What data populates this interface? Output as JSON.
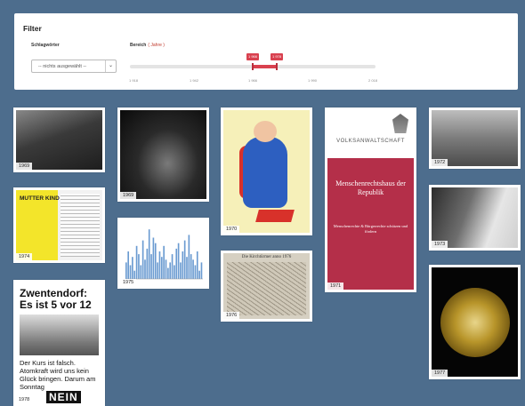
{
  "filter": {
    "title": "Filter",
    "keywords_label": "Schlagwörter",
    "range_label": "Bereich",
    "range_unit": "( Jahre )",
    "select_value": "-- nichts ausgewählt --",
    "range_from": "1 966",
    "range_to": "1 978",
    "ticks": [
      "1 918",
      "1 942",
      "1 966",
      "1 990",
      "2 018"
    ]
  },
  "items": [
    {
      "year": "1969",
      "kind": "photo-protest",
      "icon": "image-icon"
    },
    {
      "year": "1969",
      "kind": "photo-tv-studio",
      "icon": "image-icon"
    },
    {
      "year": "1970",
      "kind": "illustration-superman",
      "icon": "image-icon"
    },
    {
      "year": "1971",
      "kind": "book-cover",
      "icon": "image-icon",
      "brand": "VOLKSANWALTSCHAFT",
      "title": "Menschenrechtshaus der Republik",
      "subtitle": "Menschenrechte & Bürgerrechte schützen und fördern"
    },
    {
      "year": "1972",
      "kind": "photo-office",
      "icon": "image-icon"
    },
    {
      "year": "1974",
      "kind": "document-mutter-kind-pass",
      "icon": "image-icon",
      "title": "MUTTER KIND PASS"
    },
    {
      "year": "1975",
      "kind": "bar-chart",
      "icon": "chart-icon"
    },
    {
      "year": "1976",
      "kind": "historic-map",
      "icon": "image-icon",
      "title": "Die Kirchtürmer anno 1976"
    },
    {
      "year": "1973",
      "kind": "photo-girl",
      "icon": "image-icon"
    },
    {
      "year": "1978",
      "kind": "poster-zwentendorf",
      "icon": "image-icon",
      "headline": "Zwentendorf: Es ist 5 vor 12",
      "body": "Der Kurs ist falsch. Atomkraft wird uns kein Glück bringen. Darum am Sonntag",
      "nein": "NEIN"
    },
    {
      "year": "1977",
      "kind": "photo-golden-record",
      "icon": "image-icon"
    }
  ],
  "chart_data": {
    "type": "bar",
    "values": [
      6,
      10,
      5,
      8,
      3,
      12,
      9,
      5,
      14,
      7,
      11,
      18,
      9,
      15,
      13,
      6,
      10,
      8,
      12,
      7,
      4,
      6,
      9,
      5,
      11,
      13,
      6,
      10,
      14,
      8,
      16,
      9,
      7,
      5,
      10,
      3,
      6
    ],
    "ylim": [
      0,
      20
    ]
  }
}
